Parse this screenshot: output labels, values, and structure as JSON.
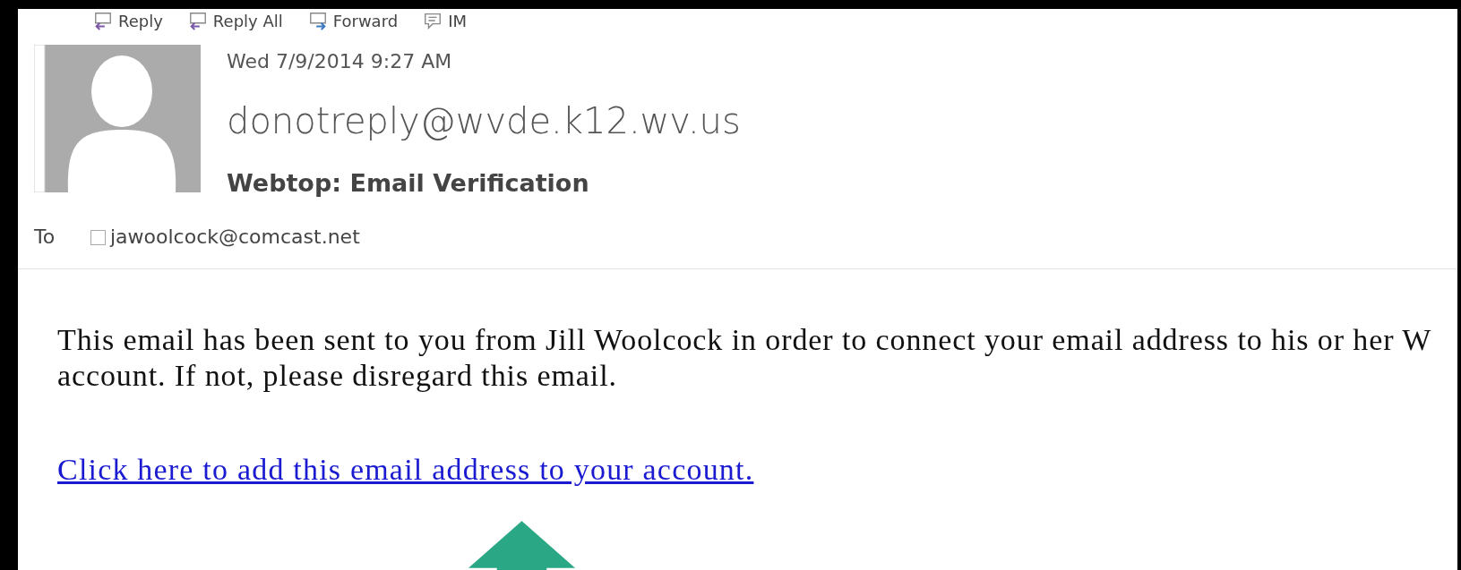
{
  "toolbar": [
    {
      "kind": "reply",
      "label": "Reply"
    },
    {
      "kind": "reply_all",
      "label": "Reply All"
    },
    {
      "kind": "forward",
      "label": "Forward"
    },
    {
      "kind": "im",
      "label": "IM"
    }
  ],
  "message": {
    "date": "Wed 7/9/2014 9:27 AM",
    "sender": "donotreply@wvde.k12.wv.us",
    "subject": "Webtop: Email Verification",
    "to_label": "To",
    "recipient": "jawoolcock@comcast.net"
  },
  "body": {
    "lines": [
      "This email has been sent to you from Jill Woolcock in order to connect your email address to his or her W",
      "account. If not, please disregard this email."
    ],
    "link": "Click here to add this email address to your account."
  }
}
